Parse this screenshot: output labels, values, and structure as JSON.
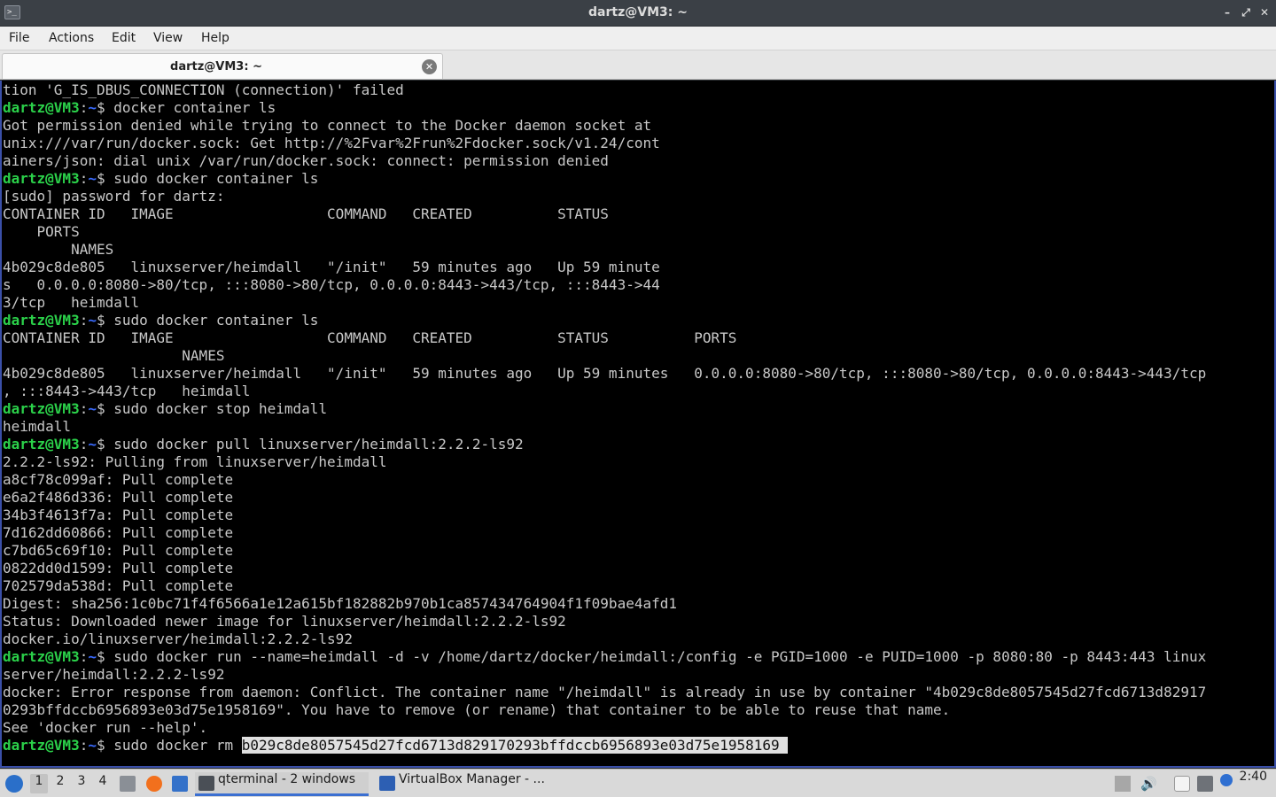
{
  "window": {
    "title": "dartz@VM3: ~",
    "minimize": "–",
    "maximize": "⤢",
    "close": "✕"
  },
  "menu": [
    "File",
    "Actions",
    "Edit",
    "View",
    "Help"
  ],
  "tab": {
    "label": "dartz@VM3: ~",
    "close": "✕"
  },
  "prompt": {
    "user": "dartz@VM3",
    "sep": ":",
    "path": "~",
    "sym": "$ "
  },
  "terminal": {
    "l0": "tion 'G_IS_DBUS_CONNECTION (connection)' failed",
    "l1": "docker container ls",
    "l2": "Got permission denied while trying to connect to the Docker daemon socket at",
    "l3": "unix:///var/run/docker.sock: Get http://%2Fvar%2Frun%2Fdocker.sock/v1.24/cont",
    "l4": "ainers/json: dial unix /var/run/docker.sock: connect: permission denied",
    "l5": "sudo docker container ls",
    "l6": "[sudo] password for dartz:",
    "l7": "CONTAINER ID   IMAGE                  COMMAND   CREATED          STATUS",
    "l8": "    PORTS",
    "l9": "        NAMES",
    "l10": "4b029c8de805   linuxserver/heimdall   \"/init\"   59 minutes ago   Up 59 minute",
    "l11": "s   0.0.0.0:8080->80/tcp, :::8080->80/tcp, 0.0.0.0:8443->443/tcp, :::8443->44",
    "l12": "3/tcp   heimdall",
    "l13": "sudo docker container ls",
    "l14": "CONTAINER ID   IMAGE                  COMMAND   CREATED          STATUS          PORTS",
    "l15": "                     NAMES",
    "l16": "4b029c8de805   linuxserver/heimdall   \"/init\"   59 minutes ago   Up 59 minutes   0.0.0.0:8080->80/tcp, :::8080->80/tcp, 0.0.0.0:8443->443/tcp",
    "l17": ", :::8443->443/tcp   heimdall",
    "l18": "sudo docker stop heimdall",
    "l19": "heimdall",
    "l20": "sudo docker pull linuxserver/heimdall:2.2.2-ls92",
    "l21": "2.2.2-ls92: Pulling from linuxserver/heimdall",
    "l22": "a8cf78c099af: Pull complete",
    "l23": "e6a2f486d336: Pull complete",
    "l24": "34b3f4613f7a: Pull complete",
    "l25": "7d162dd60866: Pull complete",
    "l26": "c7bd65c69f10: Pull complete",
    "l27": "0822dd0d1599: Pull complete",
    "l28": "702579da538d: Pull complete",
    "l29": "Digest: sha256:1c0bc71f4f6566a1e12a615bf182882b970b1ca857434764904f1f09bae4afd1",
    "l30": "Status: Downloaded newer image for linuxserver/heimdall:2.2.2-ls92",
    "l31": "docker.io/linuxserver/heimdall:2.2.2-ls92",
    "l32": "sudo docker run --name=heimdall -d -v /home/dartz/docker/heimdall:/config -e PGID=1000 -e PUID=1000 -p 8080:80 -p 8443:443 linux",
    "l33": "server/heimdall:2.2.2-ls92",
    "l34": "docker: Error response from daemon: Conflict. The container name \"/heimdall\" is already in use by container \"4b029c8de8057545d27fcd6713d82917",
    "l35": "0293bffdccb6956893e03d75e1958169\". You have to remove (or rename) that container to be able to reuse that name.",
    "l36": "See 'docker run --help'.",
    "l37": "sudo docker rm ",
    "l37_sel": "b029c8de8057545d27fcd6713d829170293bffdccb6956893e03d75e1958169 "
  },
  "taskbar": {
    "workspaces": [
      "1",
      "2",
      "3",
      "4"
    ],
    "tasks": [
      "qterminal - 2 windows",
      "VirtualBox Manager - ..."
    ],
    "clock": "2:40",
    "colors": {
      "accent": "#3b6fd1",
      "prompt_user": "#2bd14a",
      "prompt_path": "#3a6bff"
    }
  }
}
